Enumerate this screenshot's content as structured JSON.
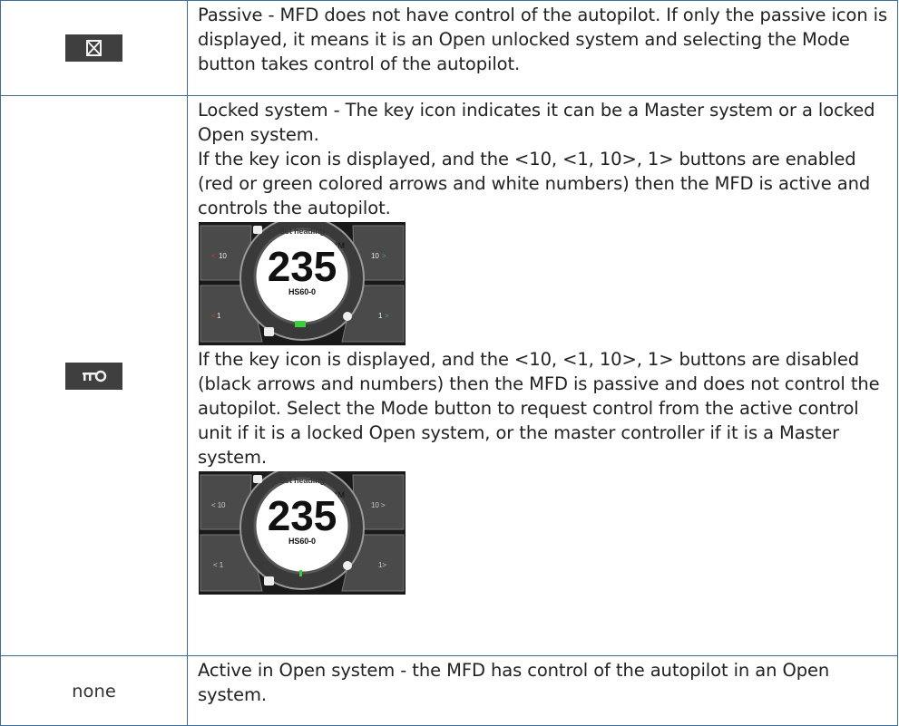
{
  "rows": [
    {
      "icon": "passive-x-icon",
      "text": "Passive - MFD does not have control of the autopilot. If only the passive icon is displayed, it means it is an Open unlocked system and selecting the Mode button takes control of the autopilot."
    },
    {
      "icon": "key-icon",
      "para1": "Locked system - The key icon indicates it can be a Master system or a locked Open system.",
      "para2": "If the key icon is displayed, and the <10, <1, 10>, 1> buttons are enabled (red or green colored arrows and white numbers) then the MFD is active and controls the autopilot.",
      "para3": "If the key icon is displayed, and the <10, <1, 10>, 1> buttons are disabled (black arrows and numbers) then the MFD is passive and does not control the autopilot. Select the Mode button to request control from the active control unit if it is a locked Open system, or the master controller if it is a Master system.",
      "screens": [
        {
          "state": "enabled",
          "label": "Set heading",
          "heading": "235",
          "unit": "°M",
          "sub": "HS60-0",
          "btn_tl": "10",
          "btn_tr": "10",
          "btn_bl": "1",
          "btn_br": "1"
        },
        {
          "state": "disabled",
          "label": "Set heading",
          "heading": "235",
          "unit": "°M",
          "sub": "HS60-0",
          "btn_tl": "< 10",
          "btn_tr": "10 >",
          "btn_bl": "< 1",
          "btn_br": "1>"
        }
      ]
    },
    {
      "icon_text": "none",
      "text": "Active in Open system - the MFD has control of the autopilot in an Open system."
    }
  ],
  "colors": {
    "border": "#3d6d9a",
    "icon_bg": "#3f3f3f",
    "arrow_red": "#d23a2c",
    "arrow_green": "#3fb34a",
    "bar_green": "#3ccf3c"
  }
}
